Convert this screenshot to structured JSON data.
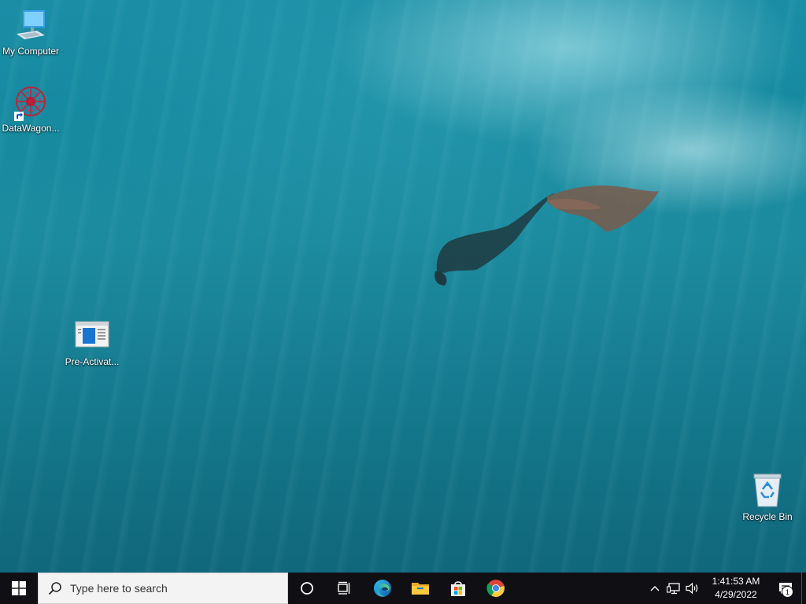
{
  "desktop": {
    "icons": [
      {
        "label": "My Computer",
        "icon": "computer-icon"
      },
      {
        "label": "DataWagon...",
        "icon": "datawagon-icon"
      },
      {
        "label": "Pre-Activat...",
        "icon": "window-icon"
      },
      {
        "label": "Recycle Bin",
        "icon": "recycle-bin-icon"
      }
    ]
  },
  "taskbar": {
    "start_icon": "windows-logo-icon",
    "search_placeholder": "Type here to search",
    "pinned": [
      {
        "name": "cortana",
        "icon": "circle-icon"
      },
      {
        "name": "task-view",
        "icon": "task-view-icon"
      },
      {
        "name": "edge",
        "icon": "edge-icon"
      },
      {
        "name": "file-explorer",
        "icon": "folder-icon"
      },
      {
        "name": "store",
        "icon": "store-icon"
      },
      {
        "name": "chrome",
        "icon": "chrome-icon"
      }
    ],
    "tray": {
      "time": "1:41:53 AM",
      "date": "4/29/2022",
      "notification_count": "1"
    }
  },
  "colors": {
    "taskbar_bg": "#101014",
    "search_bg": "#f3f3f3",
    "windows_blue": "#0078d7"
  }
}
